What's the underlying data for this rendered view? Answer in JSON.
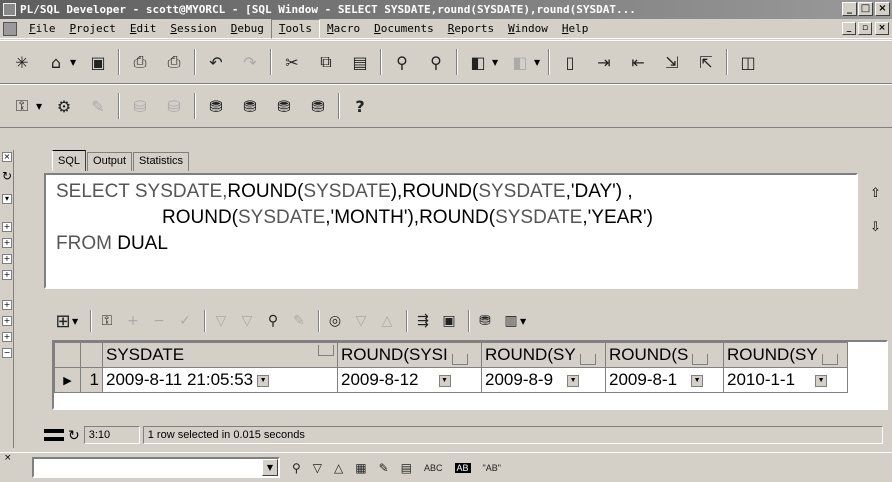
{
  "window": {
    "title": "PL/SQL Developer - scott@MYORCL - [SQL Window - SELECT SYSDATE,round(SYSDATE),round(SYSDAT..."
  },
  "menu": {
    "items": [
      "File",
      "Project",
      "Edit",
      "Session",
      "Debug",
      "Tools",
      "Macro",
      "Documents",
      "Reports",
      "Window",
      "Help"
    ],
    "active": "Tools"
  },
  "tabs": [
    "SQL",
    "Output",
    "Statistics"
  ],
  "editor": {
    "line1_kw1": "SELECT",
    "line1_a": "SYSDATE,",
    "line1_b": "ROUND(",
    "line1_c": "SYSDATE",
    "line1_d": "),",
    "line1_e": "ROUND(",
    "line1_f": "SYSDATE",
    "line1_g": ",'DAY') ,",
    "line2_a": "ROUND(",
    "line2_b": "SYSDATE",
    "line2_c": ",'MONTH'),",
    "line2_d": "ROUND(",
    "line2_e": "SYSDATE",
    "line2_f": ",'YEAR')",
    "line3_kw": "FROM",
    "line3_a": "DUAL"
  },
  "grid": {
    "columns": [
      "SYSDATE",
      "ROUND(SYSI",
      "ROUND(SY",
      "ROUND(S",
      "ROUND(SY"
    ],
    "rows": [
      {
        "num": "1",
        "cells": [
          "2009-8-11 21:05:53",
          "2009-8-12",
          "2009-8-9",
          "2009-8-1",
          "2010-1-1"
        ]
      }
    ]
  },
  "status": {
    "position": "3:10",
    "message": "1 row selected in 0.015 seconds"
  },
  "findbar": {
    "labels": {
      "abc": "ABC",
      "ab": "AB",
      "quoted": "\"AB\""
    }
  }
}
